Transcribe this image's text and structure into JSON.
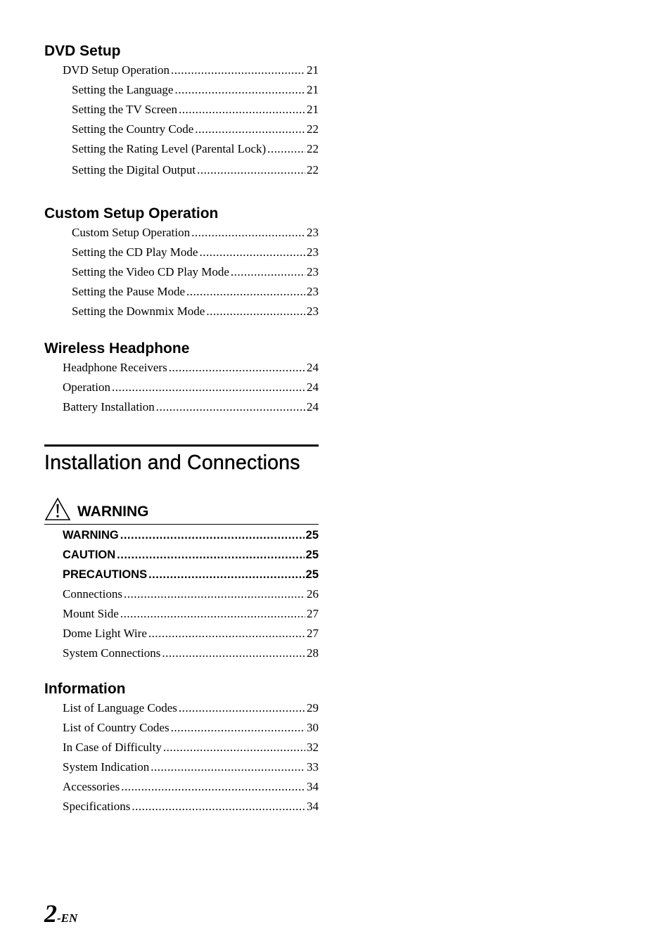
{
  "sections": {
    "dvd_setup": {
      "heading": "DVD Setup",
      "entries": [
        {
          "label": "DVD Setup Operation",
          "page": "21"
        },
        {
          "label": "Setting the Language",
          "page": "21"
        },
        {
          "label": "Setting the TV Screen",
          "page": "21"
        },
        {
          "label": "Setting the Country Code",
          "page": "22"
        },
        {
          "label": "Setting the Rating Level (Parental Lock)",
          "page": "22"
        },
        {
          "label": "Setting the Digital Output",
          "page": "22"
        }
      ]
    },
    "custom_setup": {
      "heading": "Custom Setup Operation",
      "entries": [
        {
          "label": "Custom Setup Operation",
          "page": "23"
        },
        {
          "label": "Setting the CD Play Mode",
          "page": "23"
        },
        {
          "label": "Setting the Video CD Play Mode",
          "page": "23"
        },
        {
          "label": "Setting the Pause Mode",
          "page": "23"
        },
        {
          "label": "Setting the Downmix Mode",
          "page": "23"
        }
      ]
    },
    "wireless_headphone": {
      "heading": "Wireless Headphone",
      "entries": [
        {
          "label": "Headphone Receivers",
          "page": "24"
        },
        {
          "label": "Operation",
          "page": "24"
        },
        {
          "label": "Battery Installation",
          "page": "24"
        }
      ]
    }
  },
  "chapter_title": "Installation and Connections",
  "warning_block": {
    "icon": "warning-triangle-icon",
    "heading": "WARNING",
    "entries": [
      {
        "label": "WARNING",
        "page": "25"
      },
      {
        "label": "CAUTION",
        "page": "25"
      },
      {
        "label": "PRECAUTIONS",
        "page": "25"
      },
      {
        "label": "Connections",
        "page": "26"
      },
      {
        "label": "Mount Side",
        "page": "27"
      },
      {
        "label": "Dome Light Wire",
        "page": "27"
      },
      {
        "label": "System Connections",
        "page": "28"
      }
    ]
  },
  "information": {
    "heading": "Information",
    "entries": [
      {
        "label": "List of Language Codes",
        "page": "29"
      },
      {
        "label": "List of Country Codes",
        "page": "30"
      },
      {
        "label": "In Case of Difficulty",
        "page": "32"
      },
      {
        "label": "System Indication",
        "page": "33"
      },
      {
        "label": "Accessories",
        "page": "34"
      },
      {
        "label": "Specifications",
        "page": "34"
      }
    ]
  },
  "footer": {
    "page_number": "2",
    "suffix": "-EN"
  }
}
